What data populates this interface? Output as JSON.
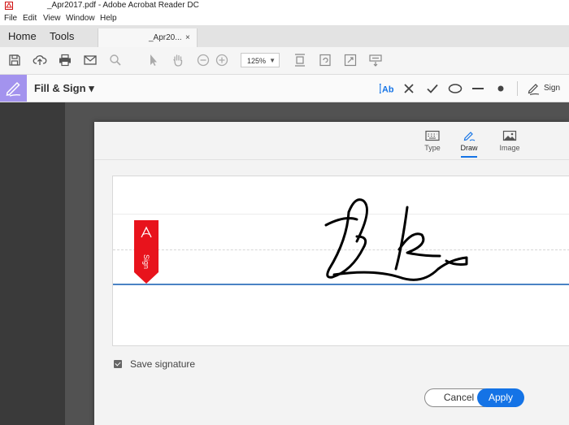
{
  "window": {
    "title": "_Apr2017.pdf - Adobe Acrobat Reader DC"
  },
  "menu": [
    "File",
    "Edit",
    "View",
    "Window",
    "Help"
  ],
  "tabs": {
    "home": "Home",
    "tools": "Tools",
    "document": "_Apr20...",
    "close": "×"
  },
  "toolbar": {
    "zoom": "125%",
    "zoom_caret": "▼"
  },
  "fillsign": {
    "title": "Fill & Sign",
    "title_caret": "▾",
    "sign_label": "Sign"
  },
  "dialog": {
    "tabs": {
      "type": "Type",
      "draw": "Draw",
      "image": "Image"
    },
    "flag_text": "Sign",
    "save_signature": "Save signature",
    "cancel": "Cancel",
    "apply": "Apply"
  },
  "colors": {
    "accent": "#1473e6",
    "fillsign_tool": "#a393ee",
    "flag": "#e8131c"
  }
}
